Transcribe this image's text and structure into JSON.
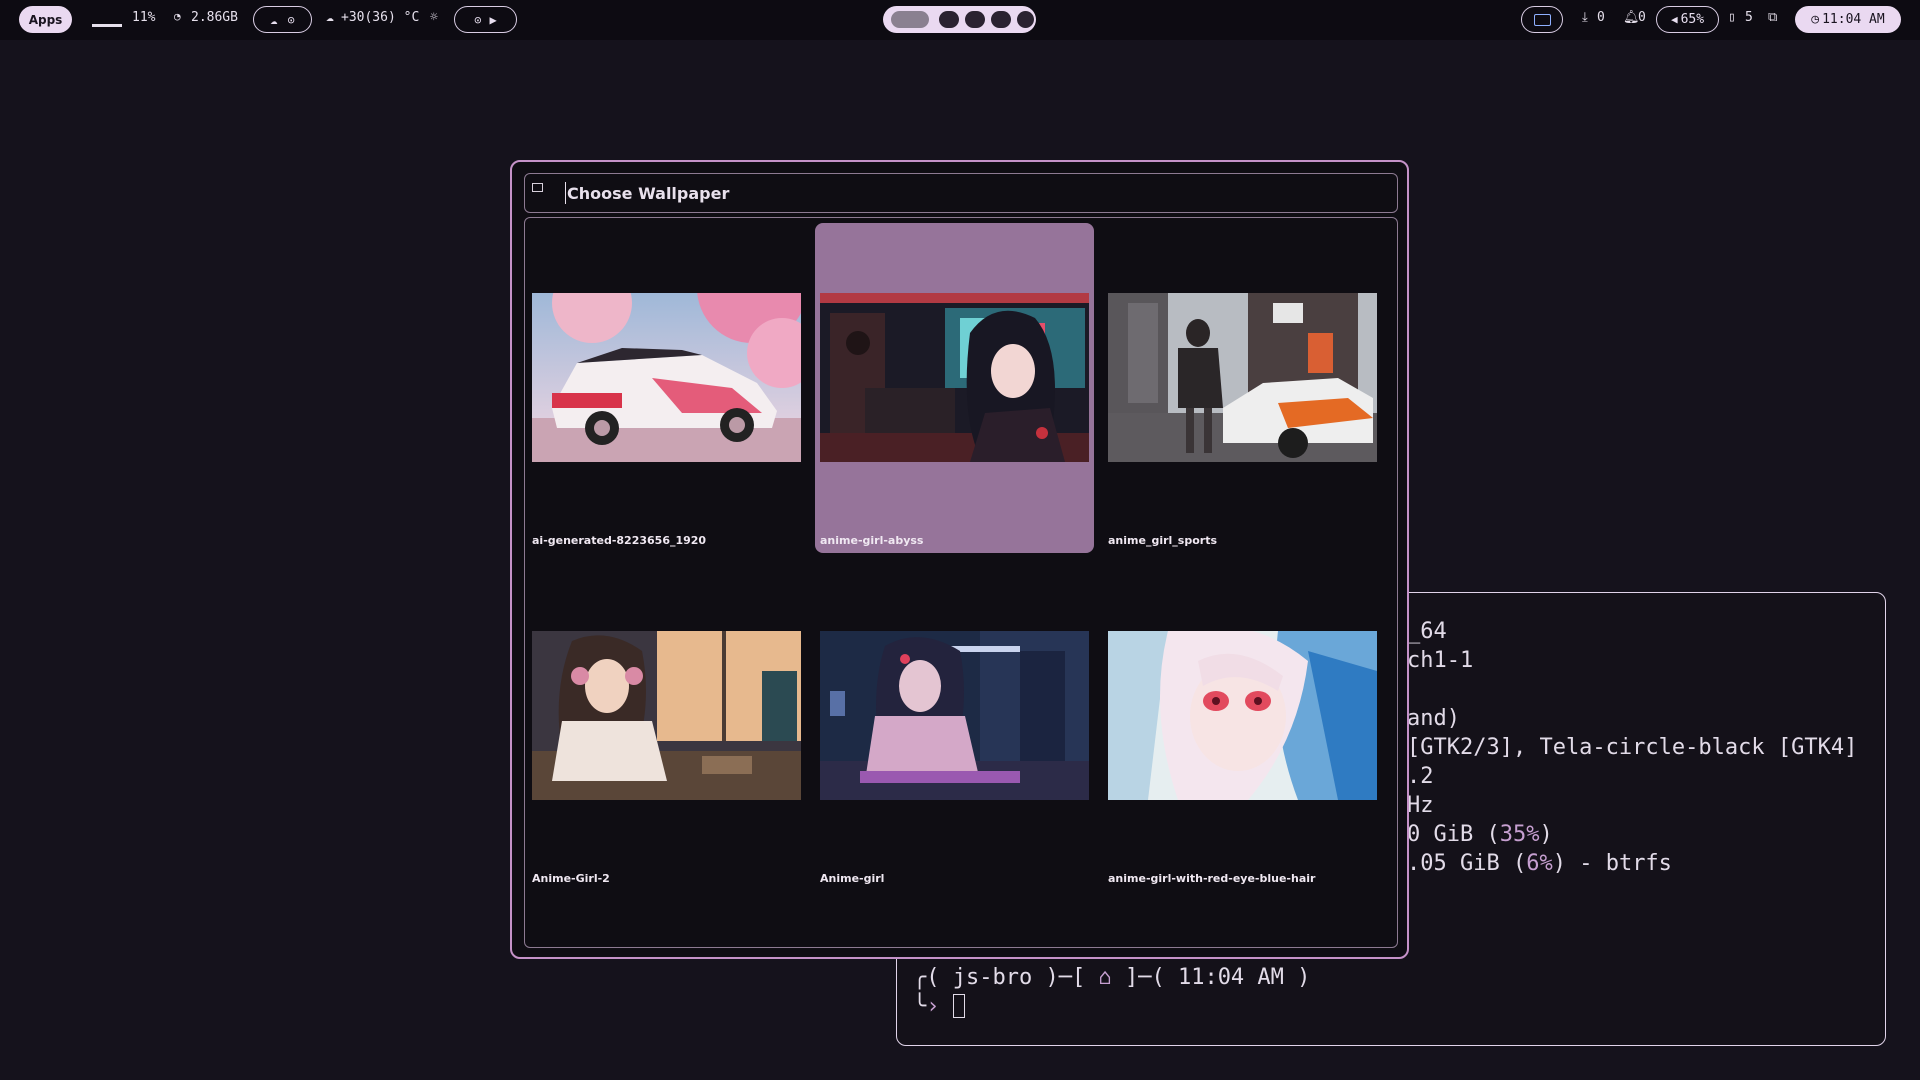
{
  "topbar": {
    "apps_label": "Apps",
    "cpu_percent": "11%",
    "memory": "2.86GB",
    "weather": "+30(36) °C",
    "download_count": "0",
    "notification_count": "0",
    "volume": "65%",
    "clipboard_count": "5",
    "clock": "11:04 AM"
  },
  "workspaces": {
    "count": 5,
    "active_index": 0
  },
  "picker": {
    "placeholder": "Choose Wallpaper",
    "wallpapers": [
      {
        "name": "ai-generated-8223656_1920"
      },
      {
        "name": "anime-girl-abyss",
        "selected": true
      },
      {
        "name": "anime_girl_sports"
      },
      {
        "name": "Anime-Girl-2"
      },
      {
        "name": "Anime-girl"
      },
      {
        "name": "anime-girl-with-red-eye-blue-hair"
      }
    ]
  },
  "terminal": {
    "lines": [
      "_64",
      "ch1-1",
      "",
      "and)",
      "[GTK2/3], Tela-circle-black [GTK4]",
      ".2",
      "Hz"
    ],
    "mem_prefix": "0 GiB (",
    "mem_percent": "35%",
    "mem_suffix": ")",
    "disk_prefix": ".05 GiB (",
    "disk_percent": "6%",
    "disk_suffix": ") - btrfs",
    "prompt_user": "js-bro",
    "prompt_time": "11:04 AM",
    "colors": {
      "accent": "#c69fd0"
    }
  }
}
